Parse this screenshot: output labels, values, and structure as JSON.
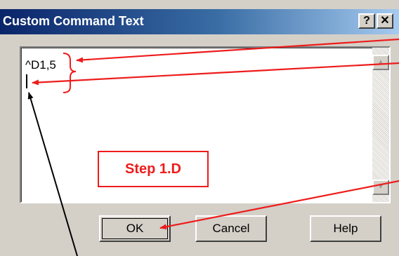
{
  "window": {
    "title": "Custom Command Text",
    "help_button": "?",
    "close_button": "✕"
  },
  "editor": {
    "line1": "^D1,5"
  },
  "scrollbar": {
    "up_arrow": "▲",
    "down_arrow": "▼"
  },
  "annotation": {
    "step_label": "Step 1.D"
  },
  "buttons": {
    "ok": "OK",
    "cancel": "Cancel",
    "help": "Help"
  },
  "colors": {
    "annotation_red": "#ee1c1c",
    "title_bar_start": "#0a246a",
    "title_bar_end": "#a6caf0",
    "dialog_face": "#d4d0c8"
  }
}
